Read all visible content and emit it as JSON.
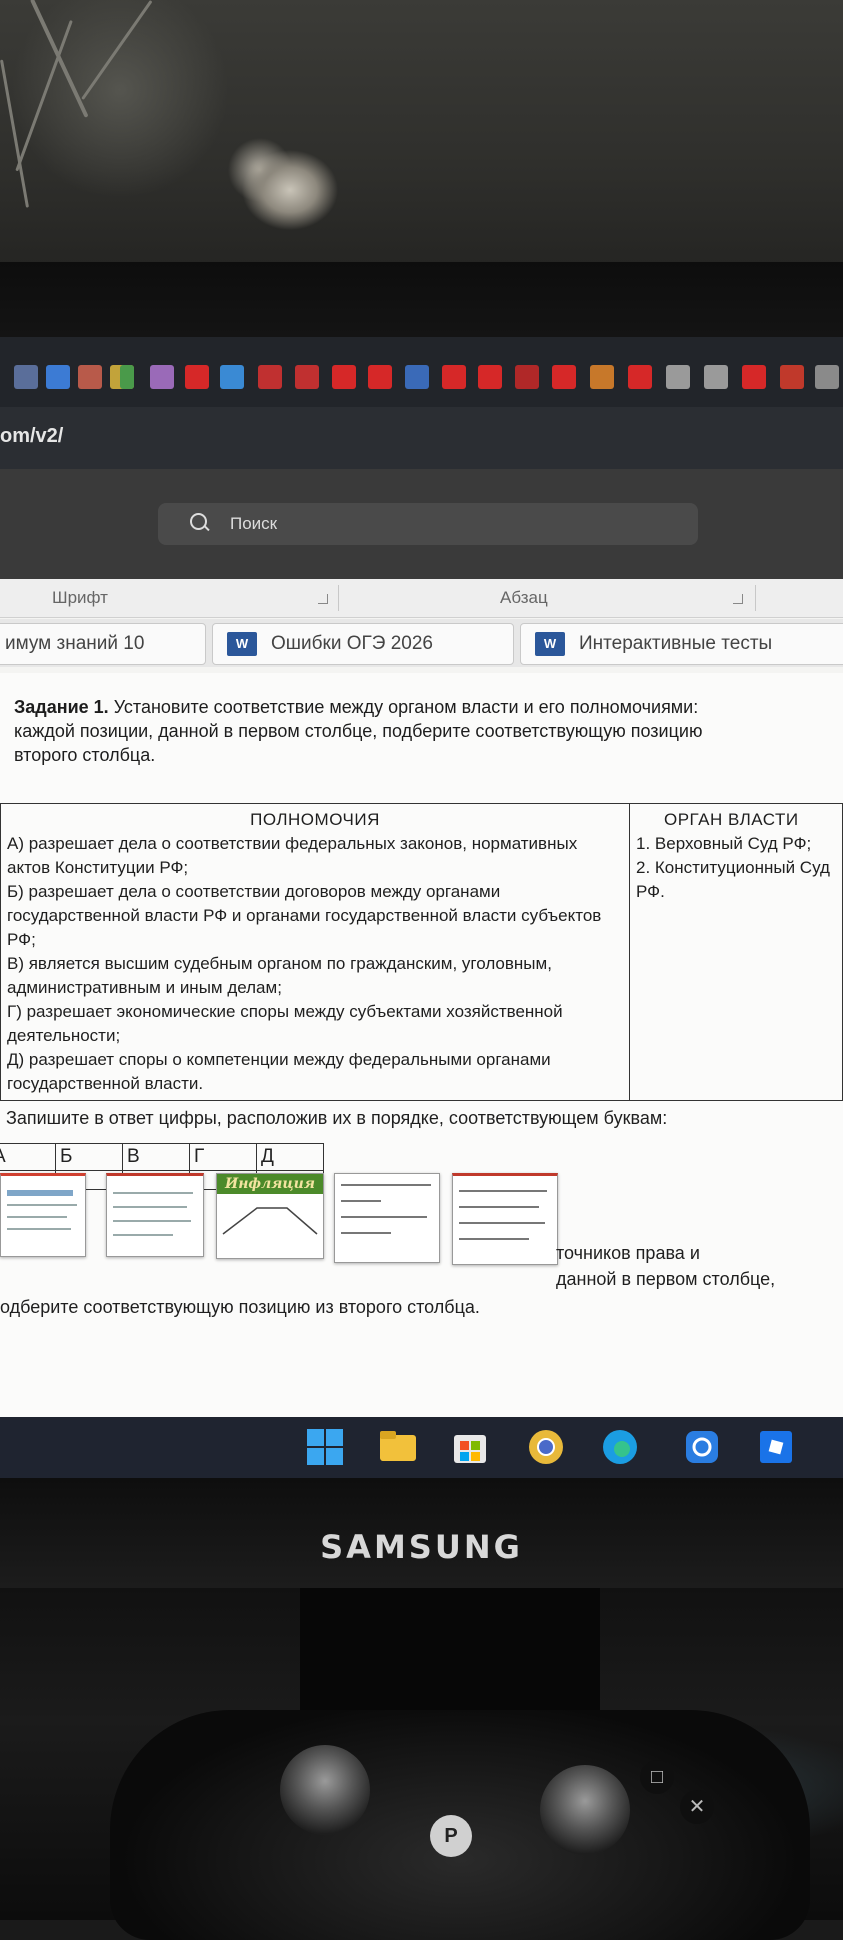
{
  "browser": {
    "address_text": "om/v2/",
    "search_placeholder": "Поиск"
  },
  "ribbon": {
    "group_font_label": "Шрифт",
    "group_paragraph_label": "Абзац"
  },
  "document_tabs": [
    {
      "label": "имум знаний 10"
    },
    {
      "label": "Ошибки ОГЭ 2026"
    },
    {
      "label": "Интерактивные тесты"
    }
  ],
  "word_icon_glyph": "W",
  "task": {
    "number_label": "Задание 1.",
    "text_line1": " Установите соответствие между органом власти и его полномочиями:",
    "text_line2": "каждой позиции, данной в первом столбце, подберите соответствующую позицию",
    "text_line3": "второго столбца."
  },
  "matching_table": {
    "left_header": "ПОЛНОМОЧИЯ",
    "right_header": "ОРГАН ВЛАСТИ",
    "left_items": [
      "А)  разрешает дела о соответствии федеральных законов, нормативных актов  Конституции РФ;",
      "Б)  разрешает дела о соответствии договоров между органами государственной власти РФ и органами государственной власти субъектов РФ;",
      "В)  является высшим судебным органом по гражданским, уголовным, административным и иным делам;",
      "Г)  разрешает экономические споры между субъектами хозяйственной деятельности;",
      "Д)  разрешает споры о компетенции между федеральными органами государственной власти."
    ],
    "right_items": [
      "1.  Верховный Суд РФ;",
      "2.  Конституционный Суд РФ."
    ]
  },
  "answer_instruction": "Запишите в ответ цифры, расположив их в порядке, соответствующем буквам:",
  "answer_letters": [
    "А",
    "Б",
    "В",
    "Г",
    "Д"
  ],
  "overlay_thumbnail_title": "Инфляция",
  "partial_text": {
    "line_a": "точников права и",
    "line_b": "данной в первом столбце,",
    "line_c": "одберите соответствующую позицию из второго столбца."
  },
  "monitor_brand": "SAMSUNG",
  "colors": {
    "word_blue": "#2b579a",
    "taskbar": "#1f2430",
    "favicon_red": "#d62828"
  }
}
